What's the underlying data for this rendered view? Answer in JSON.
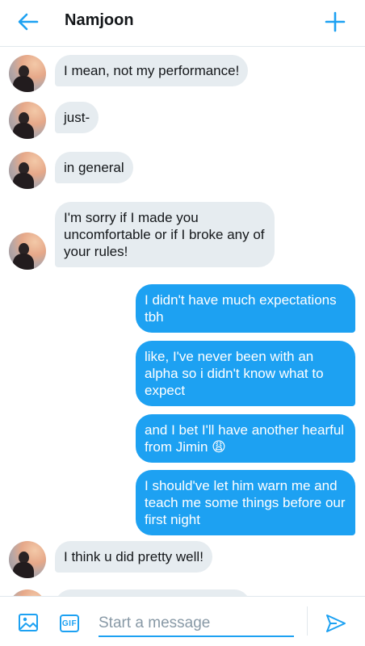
{
  "header": {
    "title": "Namjoon",
    "back_icon": "arrow-left-icon",
    "new_icon": "plus-icon"
  },
  "colors": {
    "accent": "#1da1f2",
    "incoming_bubble": "#e6ecf0",
    "text": "#14171a",
    "placeholder": "#8899a6"
  },
  "messages": [
    {
      "direction": "in",
      "text": "I mean, not my performance!"
    },
    {
      "direction": "in",
      "text": "just-"
    },
    {
      "direction": "in",
      "text": "in general"
    },
    {
      "direction": "in",
      "text": "I'm sorry if I made you uncomfortable or if I broke any of your rules!"
    },
    {
      "direction": "out",
      "text": "I didn't have much expectations tbh"
    },
    {
      "direction": "out",
      "text": "like, I've never been with an alpha so i didn't know what to expect"
    },
    {
      "direction": "out",
      "text": "and I bet I'll have another hearful from Jimin 😩"
    },
    {
      "direction": "out",
      "text": "I should've let him warn me and teach me some things before our first night"
    },
    {
      "direction": "in",
      "text": "I think u did pretty well!"
    },
    {
      "direction": "in",
      "text": ""
    }
  ],
  "composer": {
    "placeholder": "Start a message",
    "value": "",
    "image_icon": "image-icon",
    "gif_label": "GIF",
    "send_icon": "send-icon"
  }
}
